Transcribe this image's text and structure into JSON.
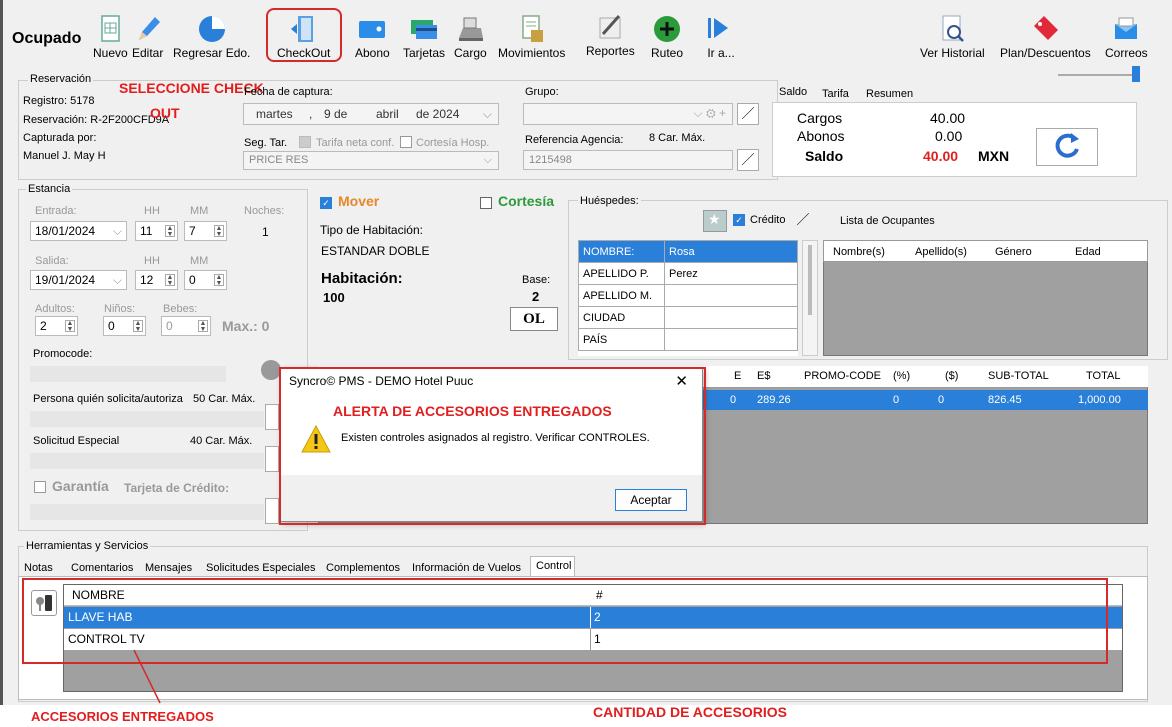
{
  "status": "Ocupado",
  "toolbar": {
    "nuevo": "Nuevo",
    "editar": "Editar",
    "regresar": "Regresar Edo.",
    "checkout": "CheckOut",
    "abono": "Abono",
    "tarjetas": "Tarjetas",
    "cargo": "Cargo",
    "movimientos": "Movimientos",
    "reportes": "Reportes",
    "ruteo": "Ruteo",
    "ir": "Ir a...",
    "ver_historial": "Ver Historial",
    "plan_descuentos": "Plan/Descuentos",
    "correos": "Correos"
  },
  "annotations": {
    "seleccione_line1": "SELECCIONE CHECK",
    "seleccione_line2": "OUT",
    "accesorios": "ACCESORIOS ENTREGADOS",
    "cantidad": "CANTIDAD DE ACCESORIOS"
  },
  "reservacion": {
    "section": "Reservación",
    "registro": "Registro: 5178",
    "reservacion": "Reservación: R-2F200CFD9A",
    "capturada_por": "Capturada por:",
    "capturista": "Manuel J.  May H",
    "fecha_label": "Fecha de captura:",
    "fecha_day": "martes",
    "fecha_comma": ",",
    "fecha_num": "9 de",
    "fecha_month": "abril",
    "fecha_year": "de 2024",
    "seg_tar": "Seg. Tar.",
    "tarifa_neta": "Tarifa neta conf.",
    "cortesia_hosp": "Cortesía Hosp.",
    "price_res": "PRICE RES",
    "grupo_label": "Grupo:",
    "ref_agencia": "Referencia Agencia:",
    "ref_max": "8 Car. Máx.",
    "ref_value": "1215498"
  },
  "saldo": {
    "tabs": [
      "Saldo",
      "Tarifa",
      "Resumen"
    ],
    "cargos_label": "Cargos",
    "cargos_value": "40.00",
    "abonos_label": "Abonos",
    "abonos_value": "0.00",
    "saldo_label": "Saldo",
    "saldo_value": "40.00",
    "currency": "MXN"
  },
  "estancia": {
    "section": "Estancia",
    "entrada": "Entrada:",
    "hh": "HH",
    "mm": "MM",
    "noches": "Noches:",
    "entrada_fecha": "18/01/2024",
    "entrada_hh": "11",
    "entrada_mm": "7",
    "noches_val": "1",
    "salida": "Salida:",
    "salida_fecha": "19/01/2024",
    "salida_hh": "12",
    "salida_mm": "0",
    "adultos": "Adultos:",
    "ninos": "Niños:",
    "bebes": "Bebes:",
    "adultos_val": "2",
    "ninos_val": "0",
    "bebes_val": "0",
    "max": "Max.: 0",
    "promocode": "Promocode:",
    "persona": "Persona quién solicita/autoriza",
    "persona_max": "50 Car. Máx.",
    "solicitud": "Solicitud Especial",
    "solicitud_max": "40 Car. Máx.",
    "garantia": "Garantía",
    "tarjeta_credito": "Tarjeta de Crédito:"
  },
  "habitacion": {
    "mover": "Mover",
    "cortesia": "Cortesía",
    "tipo_label": "Tipo de Habitación:",
    "tipo": "ESTANDAR DOBLE",
    "hab_label": "Habitación:",
    "hab_num": "100",
    "base_label": "Base:",
    "base_val": "2",
    "ol": "OL"
  },
  "huespedes": {
    "label": "Huéspedes:",
    "credito": "Crédito",
    "lista": "Lista de Ocupantes",
    "fields": [
      {
        "k": "NOMBRE:",
        "v": "Rosa"
      },
      {
        "k": "APELLIDO P.",
        "v": "Perez"
      },
      {
        "k": "APELLIDO M.",
        "v": ""
      },
      {
        "k": "CIUDAD",
        "v": ""
      },
      {
        "k": "PAÍS",
        "v": ""
      }
    ],
    "ocupantes_cols": [
      "Nombre(s)",
      "Apellido(s)",
      "Género",
      "Edad"
    ]
  },
  "rates": {
    "cols": [
      "E",
      "E$",
      "PROMO-CODE",
      "(%)",
      "($)",
      "SUB-TOTAL",
      "TOTAL"
    ],
    "row": [
      "0",
      "289.26",
      "",
      "0",
      "0",
      "826.45",
      "1,000.00"
    ]
  },
  "dialog": {
    "title": "Syncro© PMS - DEMO Hotel Puuc",
    "heading": "ALERTA DE ACCESORIOS ENTREGADOS",
    "message": "Existen controles asignados al registro. Verificar CONTROLES.",
    "ok": "Aceptar"
  },
  "herramientas": {
    "section": "Herramientas y Servicios",
    "tabs": [
      "Notas",
      "Comentarios",
      "Mensajes",
      "Solicitudes Especiales",
      "Complementos",
      "Información de Vuelos",
      "Control"
    ],
    "col_nombre": "NOMBRE",
    "col_num": "#",
    "rows": [
      {
        "nombre": "LLAVE HAB",
        "num": "2"
      },
      {
        "nombre": "CONTROL TV",
        "num": "1"
      }
    ]
  }
}
